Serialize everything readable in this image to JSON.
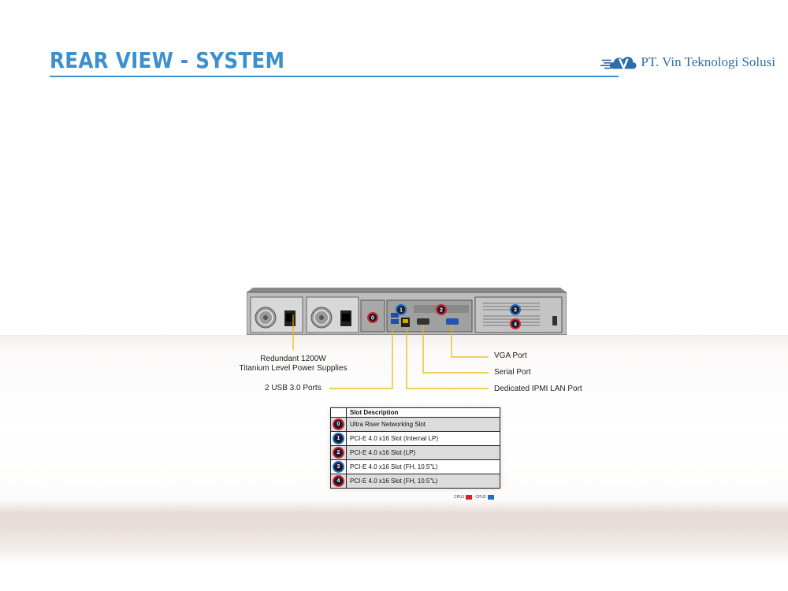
{
  "header": {
    "title": "REAR VIEW - SYSTEM",
    "company": "PT. Vin Teknologi Solusi"
  },
  "colors": {
    "title": "#3d8fce",
    "cpu1": "#d8232a",
    "cpu2": "#1f6fc0"
  },
  "server": {
    "slot_markers": [
      "0",
      "1",
      "2",
      "3",
      "4"
    ]
  },
  "callouts": {
    "psu_line1": "Redundant 1200W",
    "psu_line2": "Titanium Level Power Supplies",
    "usb": "2 USB 3.0 Ports",
    "vga": "VGA Port",
    "serial": "Serial Port",
    "ipmi": "Dedicated IPMI LAN Port"
  },
  "slot_table": {
    "header": "Slot Description",
    "rows": [
      {
        "num": "0",
        "cpu": "cpu1",
        "desc": "Ultra Riser Networking Slot"
      },
      {
        "num": "1",
        "cpu": "cpu2",
        "desc": "PCI-E 4.0 x16 Slot (Internal LP)"
      },
      {
        "num": "2",
        "cpu": "cpu1",
        "desc": "PCI-E 4.0 x16 Slot (LP)"
      },
      {
        "num": "3",
        "cpu": "cpu2",
        "desc": "PCI-E 4.0 x16 Slot (FH, 10.5\"L)"
      },
      {
        "num": "4",
        "cpu": "cpu1",
        "desc": "PCI-E 4.0 x16 Slot (FH, 10.5\"L)"
      }
    ]
  },
  "legend": {
    "cpu1": "CPU1",
    "cpu2": "CPU2"
  }
}
